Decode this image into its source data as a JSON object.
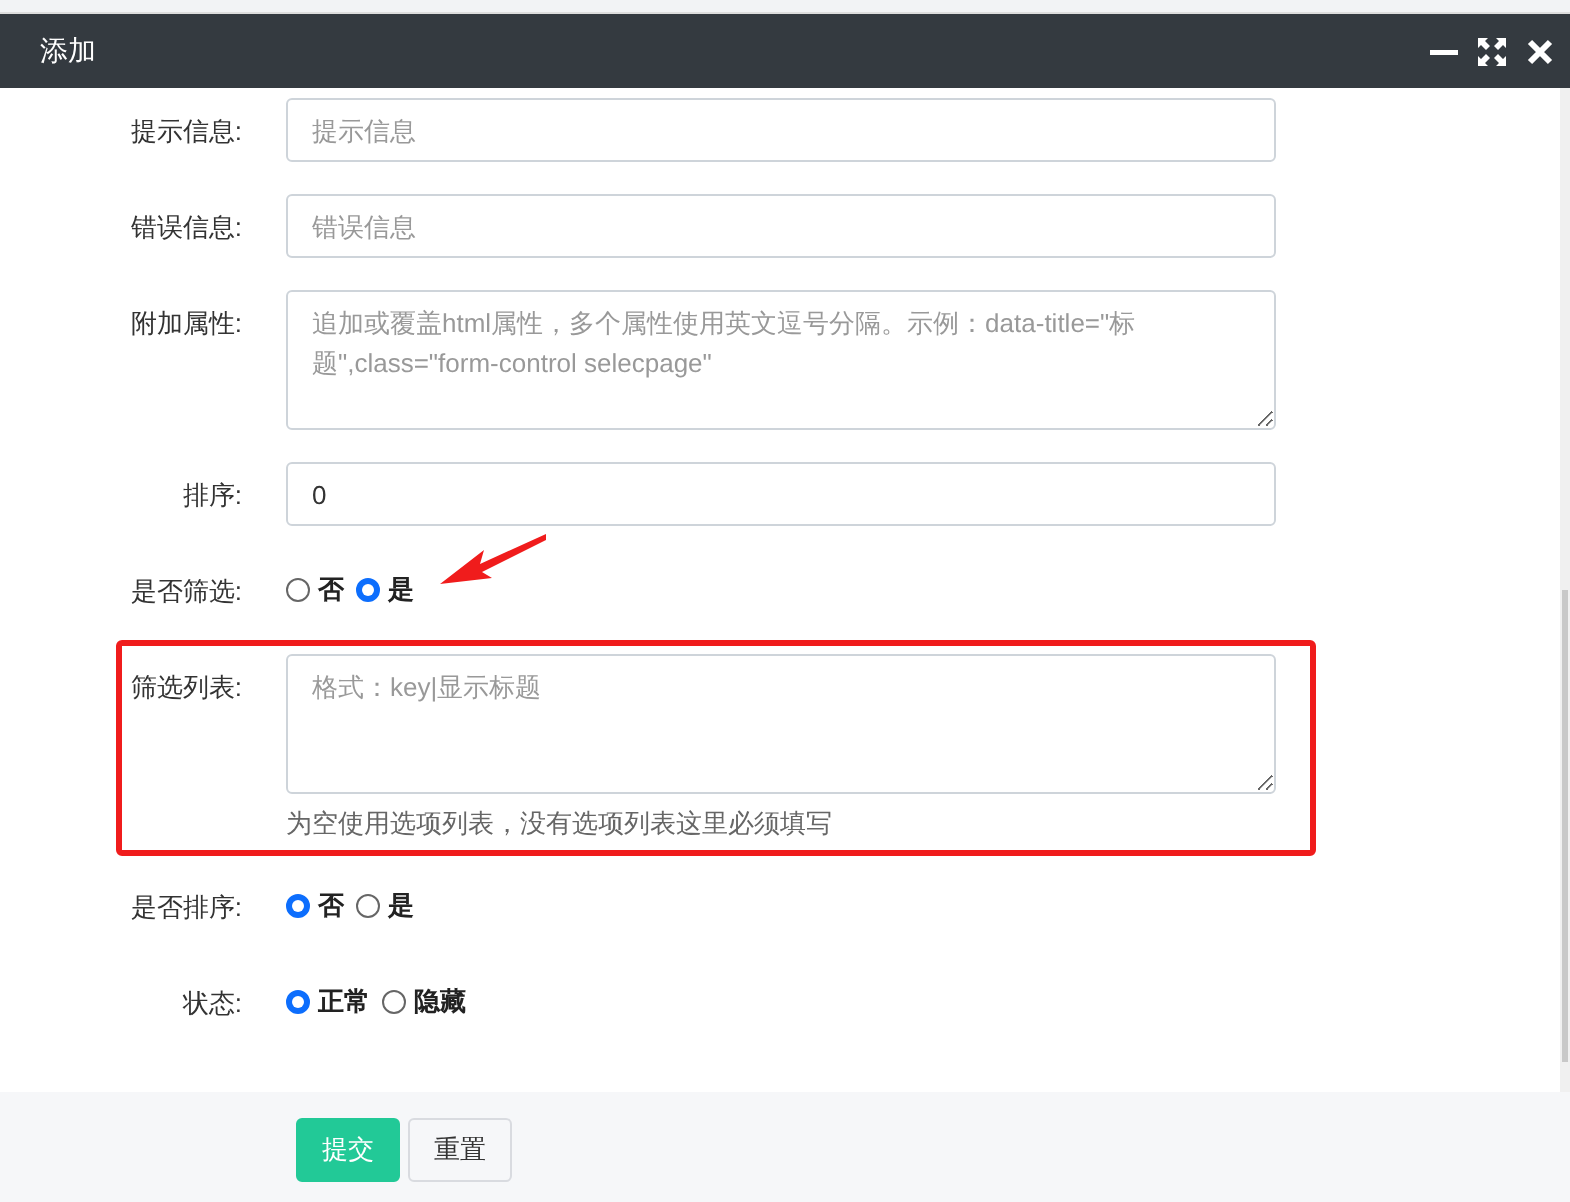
{
  "window": {
    "title": "添加"
  },
  "fields": [
    {
      "kind": "input",
      "label": "提示信息:",
      "placeholder": "提示信息"
    },
    {
      "kind": "input",
      "label": "错误信息:",
      "placeholder": "错误信息"
    },
    {
      "kind": "textarea",
      "label": "附加属性:",
      "placeholder": "追加或覆盖html属性，多个属性使用英文逗号分隔。示例：data-title=\"标题\",class=\"form-control selecpage\""
    },
    {
      "kind": "input",
      "label": "排序:",
      "value": "0"
    },
    {
      "kind": "radio",
      "label": "是否筛选:",
      "arrow": true,
      "options": [
        {
          "label": "否",
          "selected": false
        },
        {
          "label": "是",
          "selected": true
        }
      ]
    },
    {
      "kind": "textarea",
      "label": "筛选列表:",
      "highlighted": true,
      "placeholder": "格式：key|显示标题",
      "help": "为空使用选项列表，没有选项列表这里必须填写"
    },
    {
      "kind": "radio",
      "label": "是否排序:",
      "options": [
        {
          "label": "否",
          "selected": true
        },
        {
          "label": "是",
          "selected": false
        }
      ]
    },
    {
      "kind": "radio",
      "label": "状态:",
      "options": [
        {
          "label": "正常",
          "selected": true
        },
        {
          "label": "隐藏",
          "selected": false
        }
      ]
    }
  ],
  "buttons": [
    {
      "kind": "primary",
      "label": "提交"
    },
    {
      "kind": "default",
      "label": "重置"
    }
  ]
}
